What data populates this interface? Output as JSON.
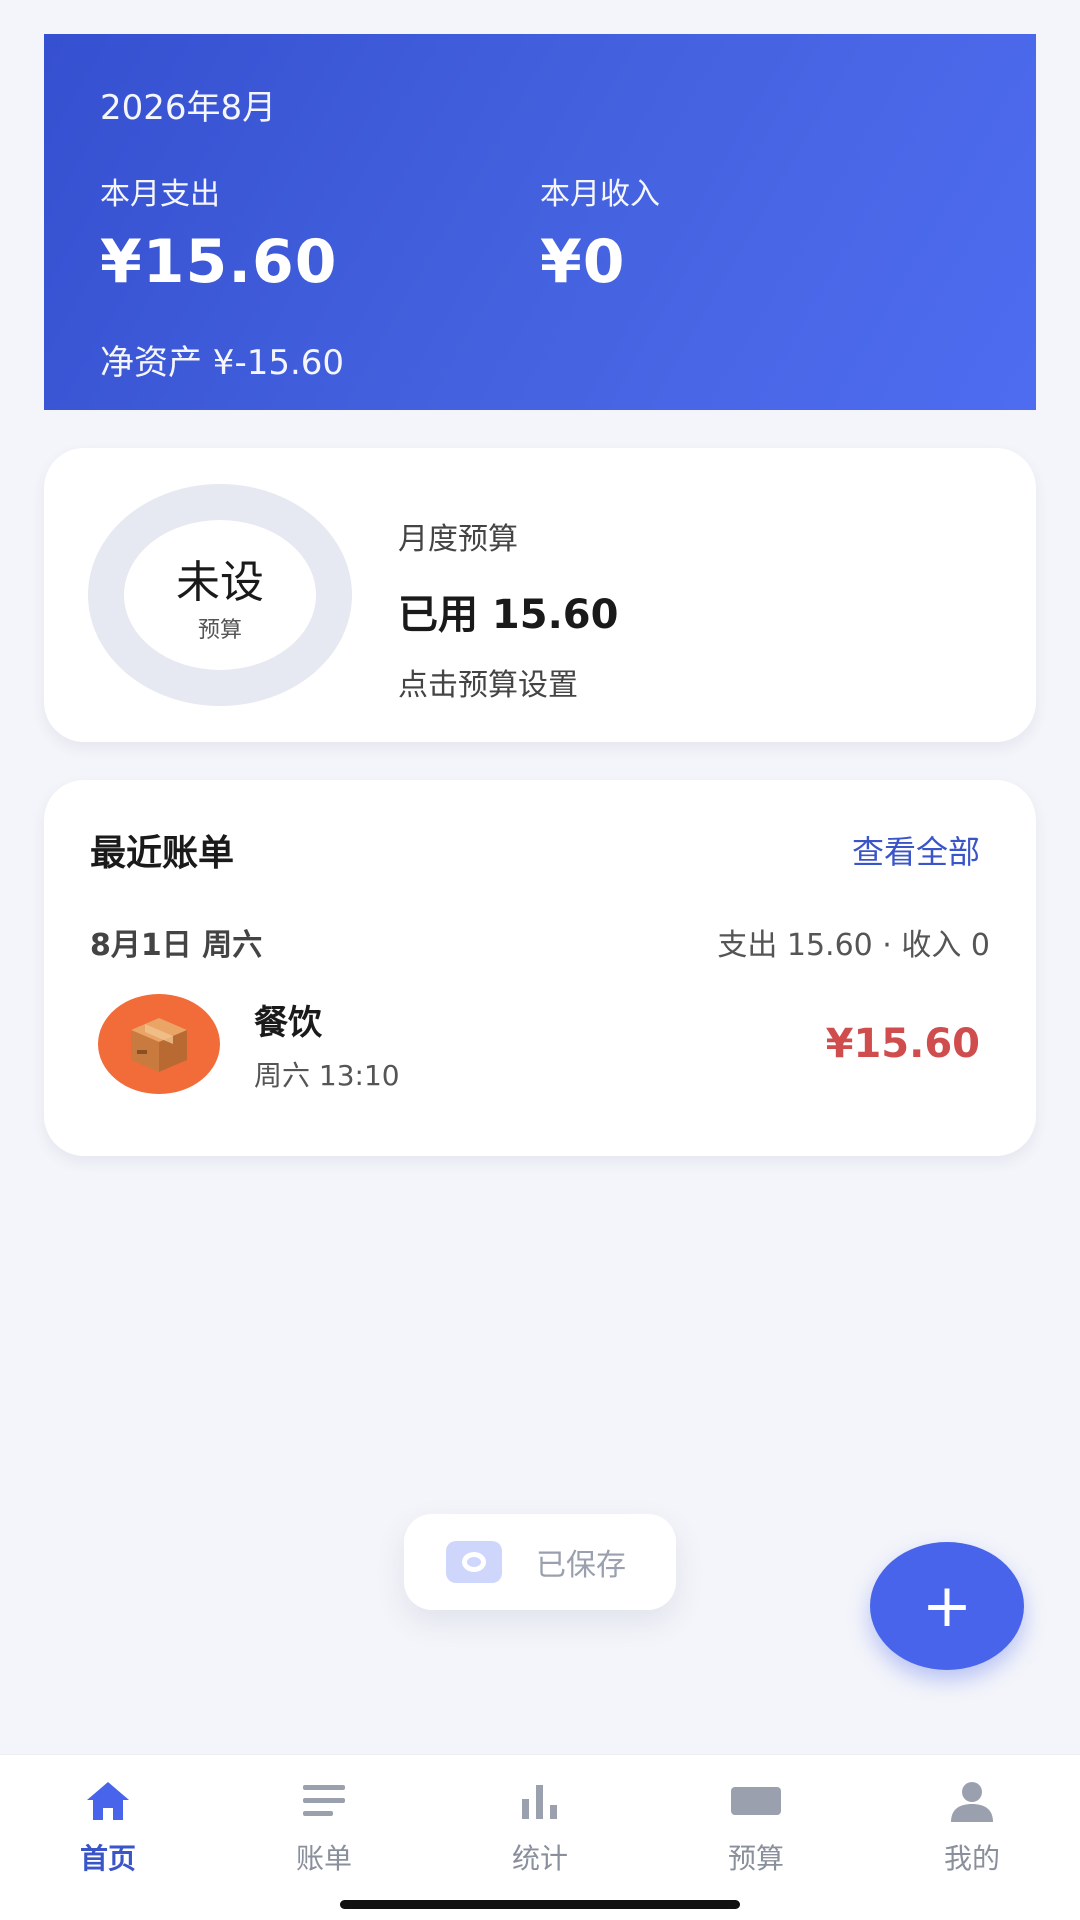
{
  "summary": {
    "month": "2026年8月",
    "expense_label": "本月支出",
    "expense_value": "¥15.60",
    "income_label": "本月收入",
    "income_value": "¥0",
    "net_assets": "净资产 ¥-15.60"
  },
  "budget": {
    "ring_main": "未设",
    "ring_sub": "预算",
    "title": "月度预算",
    "used": "已用 15.60",
    "hint": "点击预算设置"
  },
  "recent": {
    "title": "最近账单",
    "view_all": "查看全部",
    "day": {
      "date": "8月1日 周六",
      "summary": "支出 15.60 · 收入 0"
    },
    "items": [
      {
        "category": "餐饮",
        "time": "周六 13:10",
        "amount": "¥15.60",
        "icon": "package-icon"
      }
    ]
  },
  "toast": {
    "text": "已保存"
  },
  "fab": {
    "label": "+"
  },
  "tabbar": {
    "items": [
      {
        "label": "首页",
        "icon": "home-icon",
        "active": true
      },
      {
        "label": "账单",
        "icon": "list-icon",
        "active": false
      },
      {
        "label": "统计",
        "icon": "bar-chart-icon",
        "active": false
      },
      {
        "label": "预算",
        "icon": "wallet-icon",
        "active": false
      },
      {
        "label": "我的",
        "icon": "user-icon",
        "active": false
      }
    ]
  },
  "colors": {
    "primary": "#4864ea",
    "header_gradient_start": "#3550d0",
    "expense_red": "#cf4d4d",
    "category_orange": "#f26c3a"
  }
}
